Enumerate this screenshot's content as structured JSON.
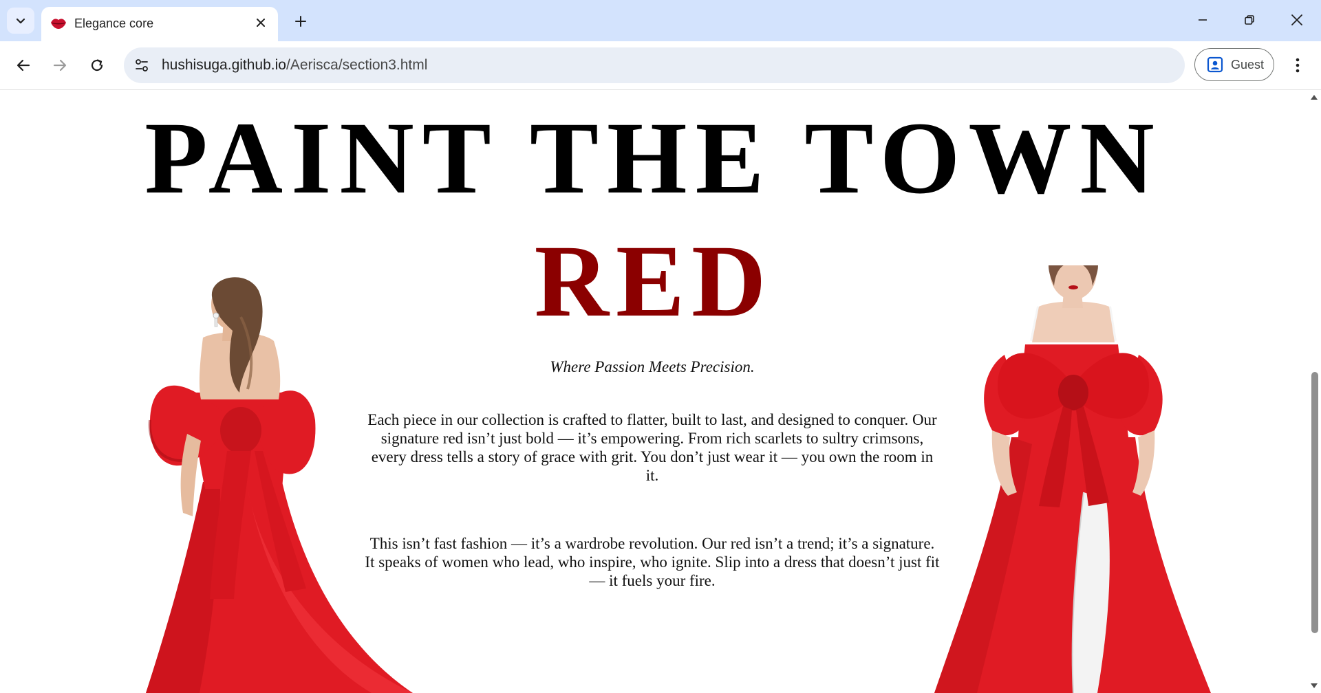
{
  "browser": {
    "tab_title": "Elegance core",
    "url_domain": "hushisuga.github.io",
    "url_path": "/Aerisca/section3.html",
    "profile_label": "Guest",
    "icons": {
      "tab_search": "chevron-down-icon",
      "favicon": "lips-icon",
      "tab_close": "close-icon",
      "new_tab": "plus-icon",
      "minimize": "minimize-icon",
      "restore": "restore-icon",
      "close_window": "close-icon",
      "back": "arrow-left-icon",
      "forward": "arrow-right-icon",
      "reload": "reload-icon",
      "site_info": "tune-icon",
      "profile": "person-badge-icon",
      "menu": "kebab-menu-icon"
    }
  },
  "page": {
    "headline": "PAINT THE TOWN",
    "headline_red": "RED",
    "tagline": "Where Passion Meets Precision.",
    "paragraph_1": "Each piece in our collection is crafted to flatter, built to last, and designed to conquer. Our signature red isn’t just bold — it’s empowering. From rich scarlets to sultry crimsons, every dress tells a story of grace with grit. You don’t just wear it — you own the room in it.",
    "paragraph_2": "This isn’t fast fashion — it’s a wardrobe revolution. Our red isn’t a trend; it’s a signature. It speaks of women who lead, who inspire, who ignite. Slip into a dress that doesn’t just fit — it fuels your fire.",
    "colors": {
      "accent_red": "#8b0000",
      "dress_red": "#e01b24",
      "text": "#000000"
    }
  }
}
